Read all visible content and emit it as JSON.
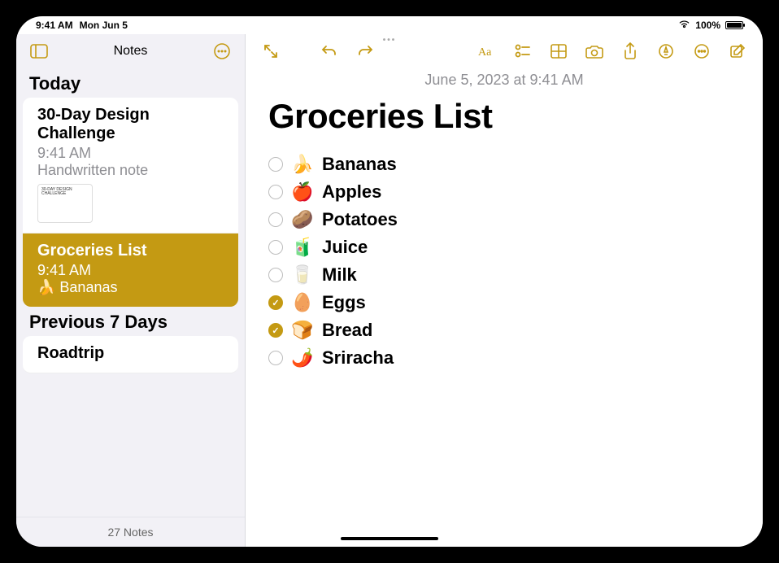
{
  "status": {
    "time": "9:41 AM",
    "date": "Mon Jun 5",
    "battery_pct": "100%"
  },
  "sidebar": {
    "title": "Notes",
    "footer": "27 Notes",
    "sections": [
      {
        "header": "Today",
        "notes": [
          {
            "title": "30-Day Design Challenge",
            "time": "9:41 AM",
            "preview": "Handwritten note",
            "has_thumb": true,
            "selected": false
          },
          {
            "title": "Groceries List",
            "time": "9:41 AM",
            "preview": "🍌 Bananas",
            "has_thumb": false,
            "selected": true
          }
        ]
      },
      {
        "header": "Previous 7 Days",
        "notes": [
          {
            "title": "Roadtrip",
            "time": "",
            "preview": "",
            "has_thumb": false,
            "selected": false
          }
        ]
      }
    ]
  },
  "editor": {
    "timestamp": "June 5, 2023 at 9:41 AM",
    "title": "Groceries List",
    "items": [
      {
        "emoji": "🍌",
        "label": "Bananas",
        "checked": false
      },
      {
        "emoji": "🍎",
        "label": "Apples",
        "checked": false
      },
      {
        "emoji": "🥔",
        "label": "Potatoes",
        "checked": false
      },
      {
        "emoji": "🧃",
        "label": "Juice",
        "checked": false
      },
      {
        "emoji": "🥛",
        "label": "Milk",
        "checked": false
      },
      {
        "emoji": "🥚",
        "label": "Eggs",
        "checked": true
      },
      {
        "emoji": "🍞",
        "label": "Bread",
        "checked": true
      },
      {
        "emoji": "🌶️",
        "label": "Sriracha",
        "checked": false
      }
    ]
  }
}
